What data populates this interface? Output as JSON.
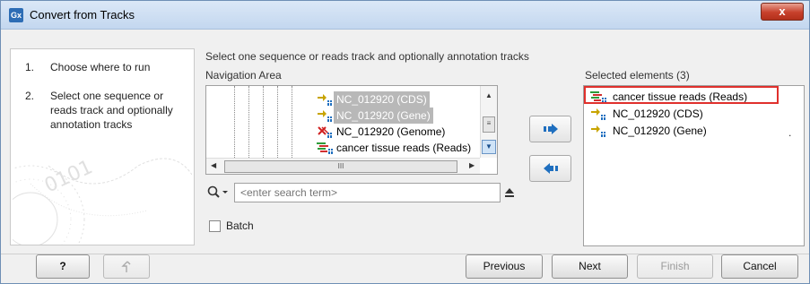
{
  "window": {
    "title": "Convert from Tracks",
    "app_icon_text": "Gx",
    "close_symbol": "x"
  },
  "steps": [
    {
      "num": "1.",
      "text": "Choose where to run"
    },
    {
      "num": "2.",
      "text": "Select one sequence or reads track and optionally annotation tracks"
    }
  ],
  "main": {
    "header": "Select one sequence or reads track and optionally annotation tracks",
    "navigation_label": "Navigation Area",
    "tree_items": [
      {
        "label": "NC_012920 (CDS)",
        "icon": "annotation-track-icon",
        "style": "greyed"
      },
      {
        "label": "NC_012920 (Gene)",
        "icon": "annotation-track-icon",
        "style": "greyed"
      },
      {
        "label": "NC_012920 (Genome)",
        "icon": "sequence-track-icon",
        "style": "normal"
      },
      {
        "label": "cancer tissue reads (Reads)",
        "icon": "reads-track-icon",
        "style": "normal"
      }
    ],
    "hscroll_grip": "III",
    "vscroll_grip": "≡",
    "search": {
      "placeholder": "<enter search term>"
    },
    "batch_label": "Batch"
  },
  "selected": {
    "label": "Selected elements (3)",
    "items": [
      {
        "label": "cancer tissue reads (Reads)",
        "icon": "reads-track-icon"
      },
      {
        "label": "NC_012920 (CDS)",
        "icon": "annotation-track-icon"
      },
      {
        "label": "NC_012920 (Gene)",
        "icon": "annotation-track-icon"
      }
    ],
    "trailing_mark": "."
  },
  "footer": {
    "help": "?",
    "reset_icon": "reset-icon",
    "previous": "Previous",
    "next": "Next",
    "finish": "Finish",
    "cancel": "Cancel"
  },
  "colors": {
    "highlight_box": "#e0302c",
    "arrow_blue": "#1f6fbf",
    "greyed_selection": "#b8b8b8"
  }
}
